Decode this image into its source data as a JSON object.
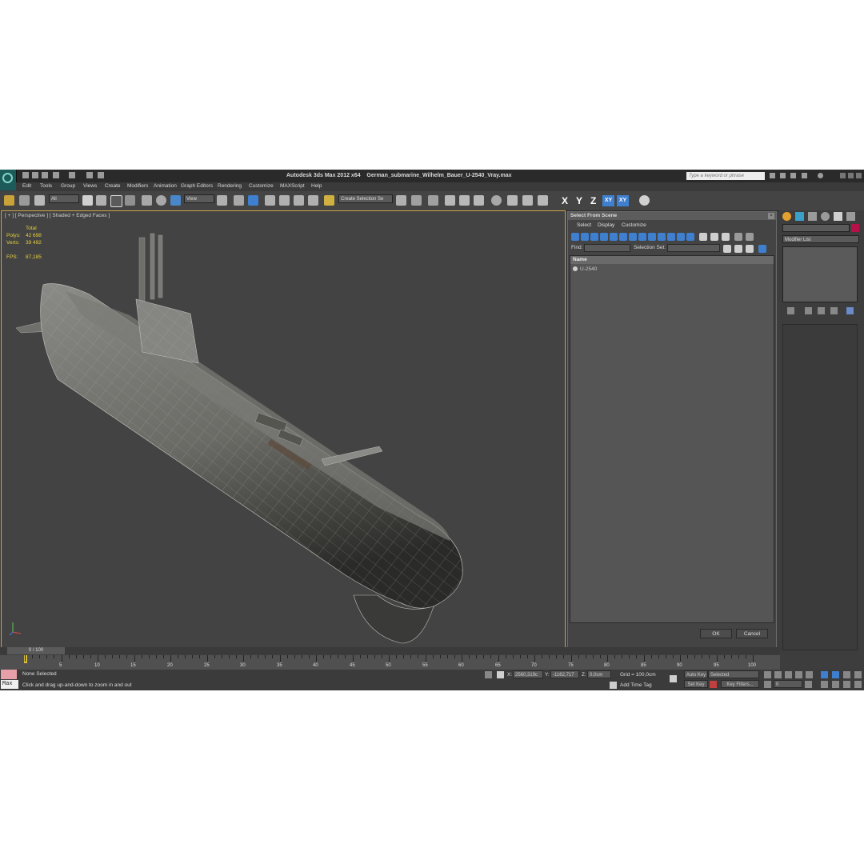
{
  "window": {
    "app_title": "Autodesk 3ds Max  2012 x64",
    "file_name": "German_submarine_Wilhelm_Bauer_U-2540_Vray.max",
    "search_placeholder": "Type a keyword or phrase"
  },
  "menu": [
    "Edit",
    "Tools",
    "Group",
    "Views",
    "Create",
    "Modifiers",
    "Animation",
    "Graph Editors",
    "Rendering",
    "Customize",
    "MAXScript",
    "Help"
  ],
  "toolbar": {
    "filter_select": "All",
    "ref_coord_select": "View",
    "selection_set": "Create Selection Se",
    "axes": [
      "X",
      "Y",
      "Z"
    ],
    "axis_buttons": [
      "XY",
      "XY"
    ]
  },
  "viewport": {
    "label": "[ + ] [ Perspective ] [ Shaded + Edged Faces ]",
    "stats_header": "Total",
    "polys_label": "Polys:",
    "polys_value": "42 698",
    "verts_label": "Verts:",
    "verts_value": "39 492",
    "fps_label": "FPS:",
    "fps_value": "87,185"
  },
  "dialog": {
    "title": "Select From Scene",
    "menu": [
      "Select",
      "Display",
      "Customize"
    ],
    "find_label": "Find:",
    "selection_set_label": "Selection Set:",
    "column_name": "Name",
    "items": [
      "U-2540"
    ],
    "ok_label": "OK",
    "cancel_label": "Cancel"
  },
  "command_panel": {
    "modifier_list": "Modifier List"
  },
  "timeline": {
    "slider_label": "0 / 100",
    "ticks": [
      "5",
      "10",
      "15",
      "20",
      "25",
      "30",
      "35",
      "40",
      "45",
      "50",
      "55",
      "60",
      "65",
      "70",
      "75",
      "80",
      "85",
      "90",
      "95",
      "100"
    ]
  },
  "status": {
    "selection": "None Selected",
    "prompt": "Click and drag up-and-down to zoom in and out",
    "x_label": "X:",
    "x_value": "2560,319c",
    "y_label": "Y:",
    "y_value": "-1162,717",
    "z_label": "Z:",
    "z_value": "0,0cm",
    "grid": "Grid = 100,0cm",
    "add_time_tag": "Add Time Tag",
    "auto_key": "Auto Key",
    "set_key": "Set Key",
    "selected_dropdown": "Selected",
    "key_filters": "Key Filters...",
    "frame_value": "0",
    "maxscript": "Max"
  },
  "colors": {
    "viewport_bg": "#434343",
    "viewport_border": "#c8a64a",
    "accent_blue": "#3e7fd0",
    "stat_yellow": "#e6cf3a"
  }
}
